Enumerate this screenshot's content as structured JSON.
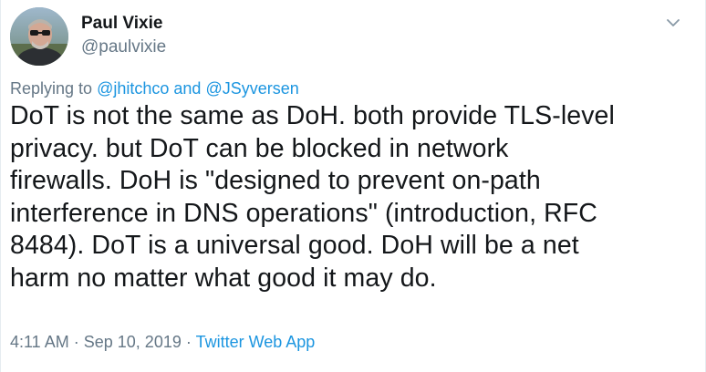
{
  "author": {
    "display_name": "Paul Vixie",
    "handle": "@paulvixie"
  },
  "replying": {
    "prefix": "Replying to",
    "user1": "@jhitchco",
    "conjunction": "and",
    "user2": "@JSyversen"
  },
  "tweet": {
    "lines": [
      "DoT is not the same as DoH. both provide TLS-level",
      "privacy. but DoT can be blocked in network",
      "firewalls. DoH is \"designed to prevent on-path",
      "interference in DNS operations\" (introduction, RFC",
      "8484). DoT is a universal good. DoH will be a net",
      "harm no matter what good it may do."
    ]
  },
  "meta": {
    "time": "4:11 AM",
    "separator": "·",
    "date": "Sep 10, 2019",
    "source": "Twitter Web App"
  },
  "icons": {
    "caret": "chevron-down-icon"
  },
  "colors": {
    "link": "#1b95e0",
    "secondary_text": "#657786",
    "primary_text": "#14171a"
  }
}
